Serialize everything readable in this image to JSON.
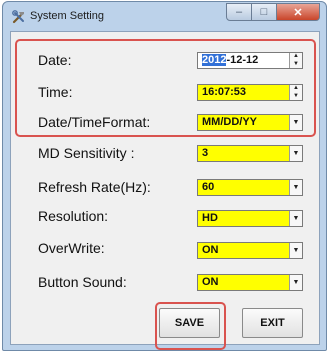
{
  "window": {
    "title": "System Setting",
    "minimize_icon": "minimize-icon",
    "maximize_icon": "maximize-icon",
    "close_icon": "close-icon",
    "app_icon": "tools-icon"
  },
  "fields": {
    "date": {
      "label": "Date:",
      "year": "2012",
      "rest": "-12-12"
    },
    "time": {
      "label": "Time:",
      "value": "16:07:53"
    },
    "format": {
      "label": "Date/TimeFormat:",
      "value": "MM/DD/YY"
    },
    "md_sensitivity": {
      "label": "MD Sensitivity :",
      "value": "3"
    },
    "refresh_rate": {
      "label": "Refresh Rate(Hz):",
      "value": "60"
    },
    "resolution": {
      "label": "Resolution:",
      "value": "HD"
    },
    "overwrite": {
      "label": "OverWrite:",
      "value": "ON"
    },
    "button_sound": {
      "label": "Button Sound:",
      "value": "ON"
    }
  },
  "buttons": {
    "save": "SAVE",
    "exit": "EXIT"
  },
  "colors": {
    "field_bg": "#ffff00",
    "highlight_frame": "#d9534f",
    "selection": "#3170d7"
  }
}
